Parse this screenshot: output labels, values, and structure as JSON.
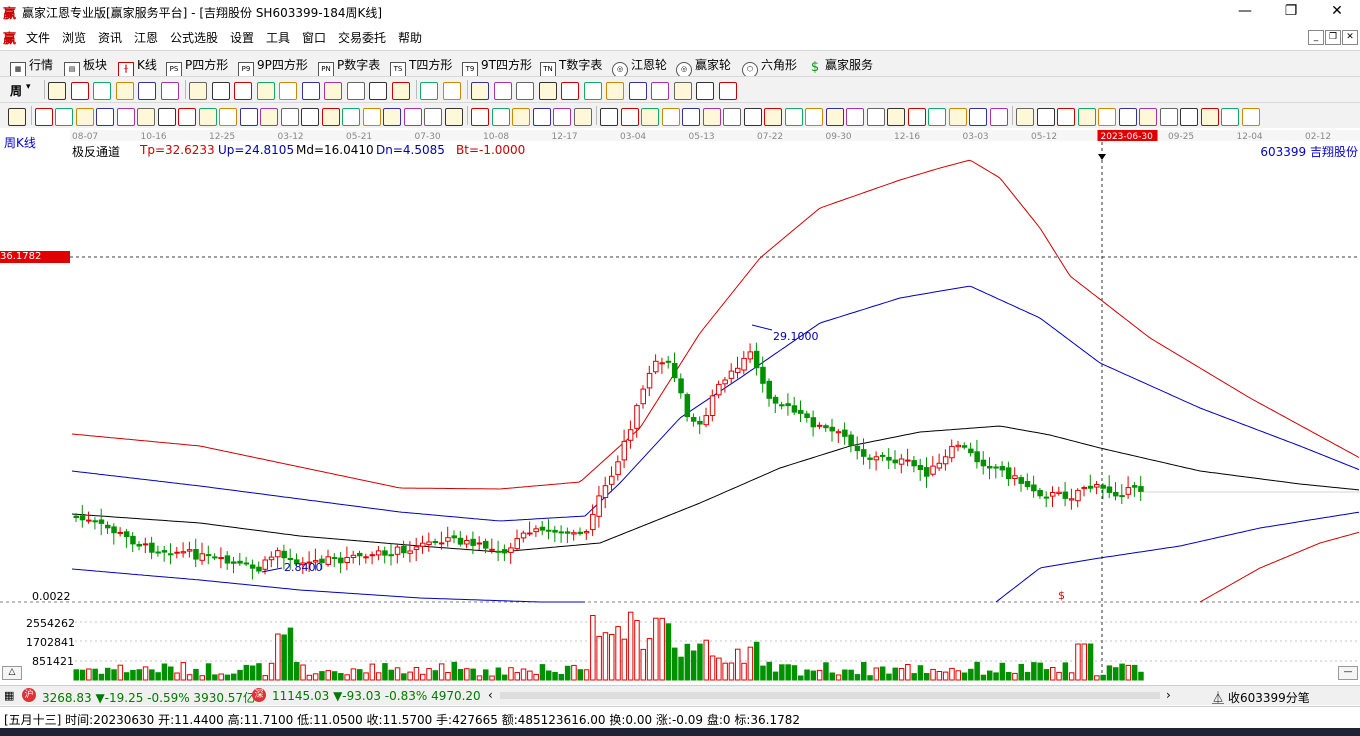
{
  "window": {
    "logo": "赢",
    "title": "赢家江恩专业版[赢家服务平台] - [吉翔股份 SH603399-184周K线]",
    "minimize": "—",
    "restore": "❐",
    "close": "✕"
  },
  "menu": {
    "logo": "赢",
    "items": [
      "文件",
      "浏览",
      "资讯",
      "江恩",
      "公式选股",
      "设置",
      "工具",
      "窗口",
      "交易委托",
      "帮助"
    ],
    "mdi": [
      "_",
      "❐",
      "✕"
    ]
  },
  "toolbar1": {
    "items": [
      {
        "label": "行情",
        "icon": "grid-icon"
      },
      {
        "label": "板块",
        "icon": "blocks-icon"
      },
      {
        "label": "K线",
        "icon": "kline-icon"
      },
      {
        "label": "P四方形",
        "icon": "PS"
      },
      {
        "label": "9P四方形",
        "icon": "P9"
      },
      {
        "label": "P数字表",
        "icon": "PN"
      },
      {
        "label": "T四方形",
        "icon": "TS"
      },
      {
        "label": "9T四方形",
        "icon": "T9"
      },
      {
        "label": "T数字表",
        "icon": "TN"
      },
      {
        "label": "江恩轮",
        "icon": "gann-wheel-icon"
      },
      {
        "label": "赢家轮",
        "icon": "winner-wheel-icon"
      },
      {
        "label": "六角形",
        "icon": "hexagon-icon"
      },
      {
        "label": "赢家服务",
        "icon": "dollar-icon"
      }
    ]
  },
  "toolbar2": {
    "period": "周"
  },
  "chart": {
    "period_label": "周K线",
    "indicator_name": "极反通道",
    "params": [
      {
        "text": "Tp=32.6233",
        "color": "#cc0000"
      },
      {
        "text": "Up=24.8105",
        "color": "#0000aa"
      },
      {
        "text": "Md=16.0410",
        "color": "#000000"
      },
      {
        "text": "Dn=4.5085",
        "color": "#0000aa"
      },
      {
        "text": "Bt=-1.0000",
        "color": "#cc0000"
      }
    ],
    "stock": "603399 吉翔股份",
    "dates": [
      "08-07",
      "10-16",
      "12-25",
      "03-12",
      "05-21",
      "07-30",
      "10-08",
      "12-17",
      "03-04",
      "05-13",
      "07-22",
      "09-30",
      "12-16",
      "03-03",
      "05-12",
      "2023-06-30",
      "09-25",
      "12-04",
      "02-12"
    ],
    "selected_date": "2023-06-30",
    "price_marker": "36.1782",
    "high_label": "29.1000",
    "low_label": "2.8400",
    "bottom_label": "0.0022",
    "dollar_mark": "$",
    "volume_labels": [
      "2554262",
      "1702841",
      "851421"
    ],
    "colors": {
      "up": "#e00000",
      "down": "#009000",
      "upper": "#d00000",
      "mid": "#000000",
      "lower": "#0000bb"
    }
  },
  "status": {
    "sh_index": "3268.83 ▼-19.25 -0.59% 3930.57亿",
    "sz_index": "11145.03 ▼-93.03 -0.83% 4970.20",
    "right": "收603399分笔"
  },
  "info": {
    "text": "[五月十三] 时间:20230630 开:11.4400 高:11.7100 低:11.0500 收:11.5700 手:427665 额:485123616.00 换:0.00 涨:-0.09 盘:0 标:36.1782"
  },
  "chart_data": {
    "type": "candlestick",
    "title": "极反通道",
    "x_tick_labels": [
      "08-07",
      "10-16",
      "12-25",
      "03-12",
      "05-21",
      "07-30",
      "10-08",
      "12-17",
      "03-04",
      "05-13",
      "07-22",
      "09-30",
      "12-16",
      "03-03",
      "05-12",
      "2023-06-30",
      "09-25",
      "12-04",
      "02-12"
    ],
    "y_unit": "price",
    "ylim": [
      0.0022,
      40
    ],
    "annotations": [
      {
        "text": "29.1000",
        "kind": "period high"
      },
      {
        "text": "2.8400",
        "kind": "period low"
      },
      {
        "text": "36.1782",
        "kind": "horizontal marker"
      }
    ],
    "series": [
      {
        "name": "Tp",
        "last_value": 32.6233
      },
      {
        "name": "Up",
        "last_value": 24.8105
      },
      {
        "name": "Md",
        "last_value": 16.041
      },
      {
        "name": "Dn",
        "last_value": 4.5085
      },
      {
        "name": "Bt",
        "last_value": -1.0
      }
    ],
    "selected_bar": {
      "date": "2023-06-30",
      "open": 11.44,
      "high": 11.71,
      "low": 11.05,
      "close": 11.57,
      "volume": 427665
    }
  }
}
